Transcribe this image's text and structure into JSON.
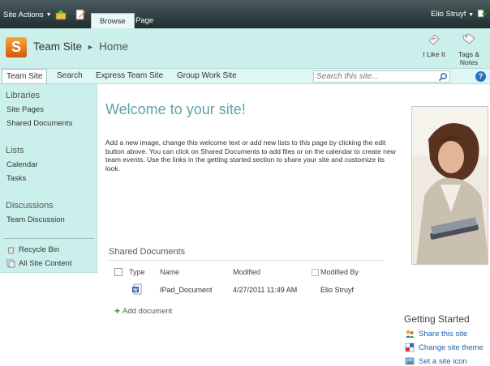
{
  "ribbon": {
    "site_actions": "Site Actions",
    "tabs": [
      "Browse",
      "Page"
    ],
    "user": "Elio Struyf"
  },
  "title_area": {
    "logo_letter": "S",
    "site_name": "Team Site",
    "page_name": "Home",
    "social": [
      {
        "label_lines": [
          "I Like It"
        ],
        "icon": "i-like-it-icon"
      },
      {
        "label_lines": [
          "Tags &",
          "Notes"
        ],
        "icon": "tags-notes-icon"
      }
    ]
  },
  "topnav": {
    "items": [
      "Team Site",
      "Search",
      "Express Team Site",
      "Group Work Site"
    ],
    "search_placeholder": "Search this site...",
    "help": "?"
  },
  "leftnav": {
    "libraries_heading": "Libraries",
    "libraries": [
      "Site Pages",
      "Shared Documents"
    ],
    "lists_heading": "Lists",
    "lists": [
      "Calendar",
      "Tasks"
    ],
    "discussions_heading": "Discussions",
    "discussions": [
      "Team Discussion"
    ],
    "recycle_bin": "Recycle Bin",
    "all_site_content": "All Site Content"
  },
  "main": {
    "welcome": "Welcome to your site!",
    "intro": "Add a new image, change this welcome text or add new lists to this page by clicking the edit button above. You can click on Shared Documents to add files or on the calendar to create new team events. Use the links in the getting started section to share your site and customize its look."
  },
  "shared_documents": {
    "title": "Shared Documents",
    "columns": [
      "Type",
      "Name",
      "Modified",
      "Modified By"
    ],
    "rows": [
      {
        "name": "IPad_Document",
        "modified": "4/27/2011 11:49 AM",
        "modified_by": "Elio Struyf"
      }
    ],
    "add_label": "Add document"
  },
  "getting_started": {
    "title": "Getting Started",
    "items": [
      {
        "label": "Share this site",
        "icon": "share-site-icon"
      },
      {
        "label": "Change site theme",
        "icon": "site-theme-icon"
      },
      {
        "label": "Set a site icon",
        "icon": "site-icon-icon"
      }
    ]
  },
  "colors": {
    "accent": "#5fa3a2",
    "panel": "#cbf0ec",
    "link": "#1d5fb8"
  }
}
